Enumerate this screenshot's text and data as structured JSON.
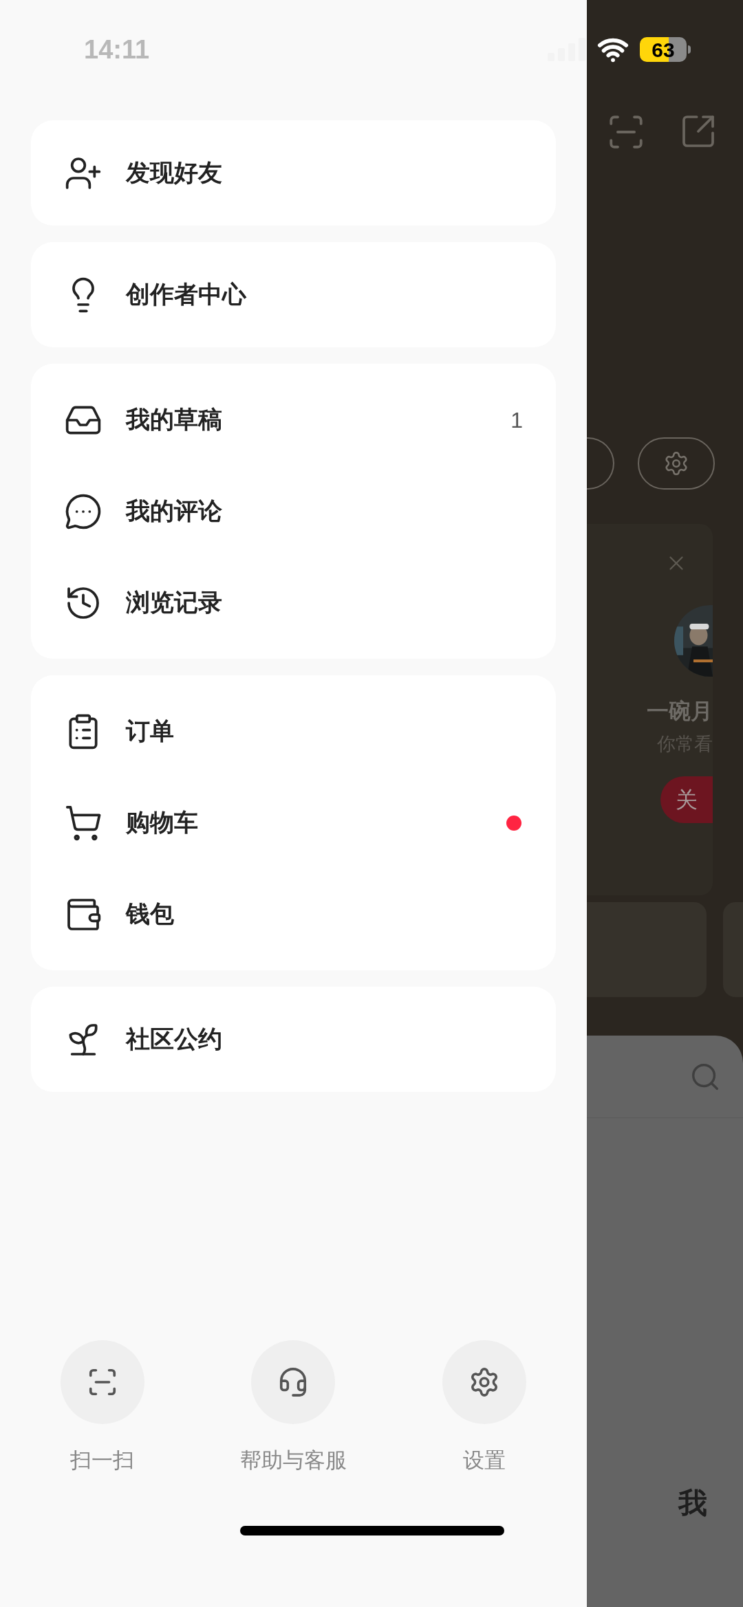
{
  "status_bar": {
    "time": "14:11",
    "battery": "63"
  },
  "menu_groups": [
    {
      "items": [
        {
          "kind": "add-friend",
          "label": "发现好友",
          "dot": false
        }
      ]
    },
    {
      "items": [
        {
          "kind": "creator",
          "label": "创作者中心",
          "dot": false
        }
      ]
    },
    {
      "items": [
        {
          "kind": "drafts",
          "label": "我的草稿",
          "count": "1",
          "dot": false
        },
        {
          "kind": "comments",
          "label": "我的评论",
          "dot": false
        },
        {
          "kind": "history",
          "label": "浏览记录",
          "dot": false
        }
      ]
    },
    {
      "items": [
        {
          "kind": "orders",
          "label": "订单",
          "dot": false
        },
        {
          "kind": "cart",
          "label": "购物车",
          "dot": true
        },
        {
          "kind": "wallet",
          "label": "钱包",
          "dot": false
        }
      ]
    },
    {
      "items": [
        {
          "kind": "guidelines",
          "label": "社区公约",
          "dot": false
        }
      ]
    }
  ],
  "bottom_actions": [
    {
      "kind": "scan",
      "label": "扫一扫"
    },
    {
      "kind": "support",
      "label": "帮助与客服"
    },
    {
      "kind": "settings",
      "label": "设置"
    }
  ],
  "background": {
    "suggested_user": {
      "name": "一碗月",
      "subtitle": "你常看",
      "follow_button": "关"
    },
    "tab_bar": {
      "current_tab": "我"
    }
  }
}
